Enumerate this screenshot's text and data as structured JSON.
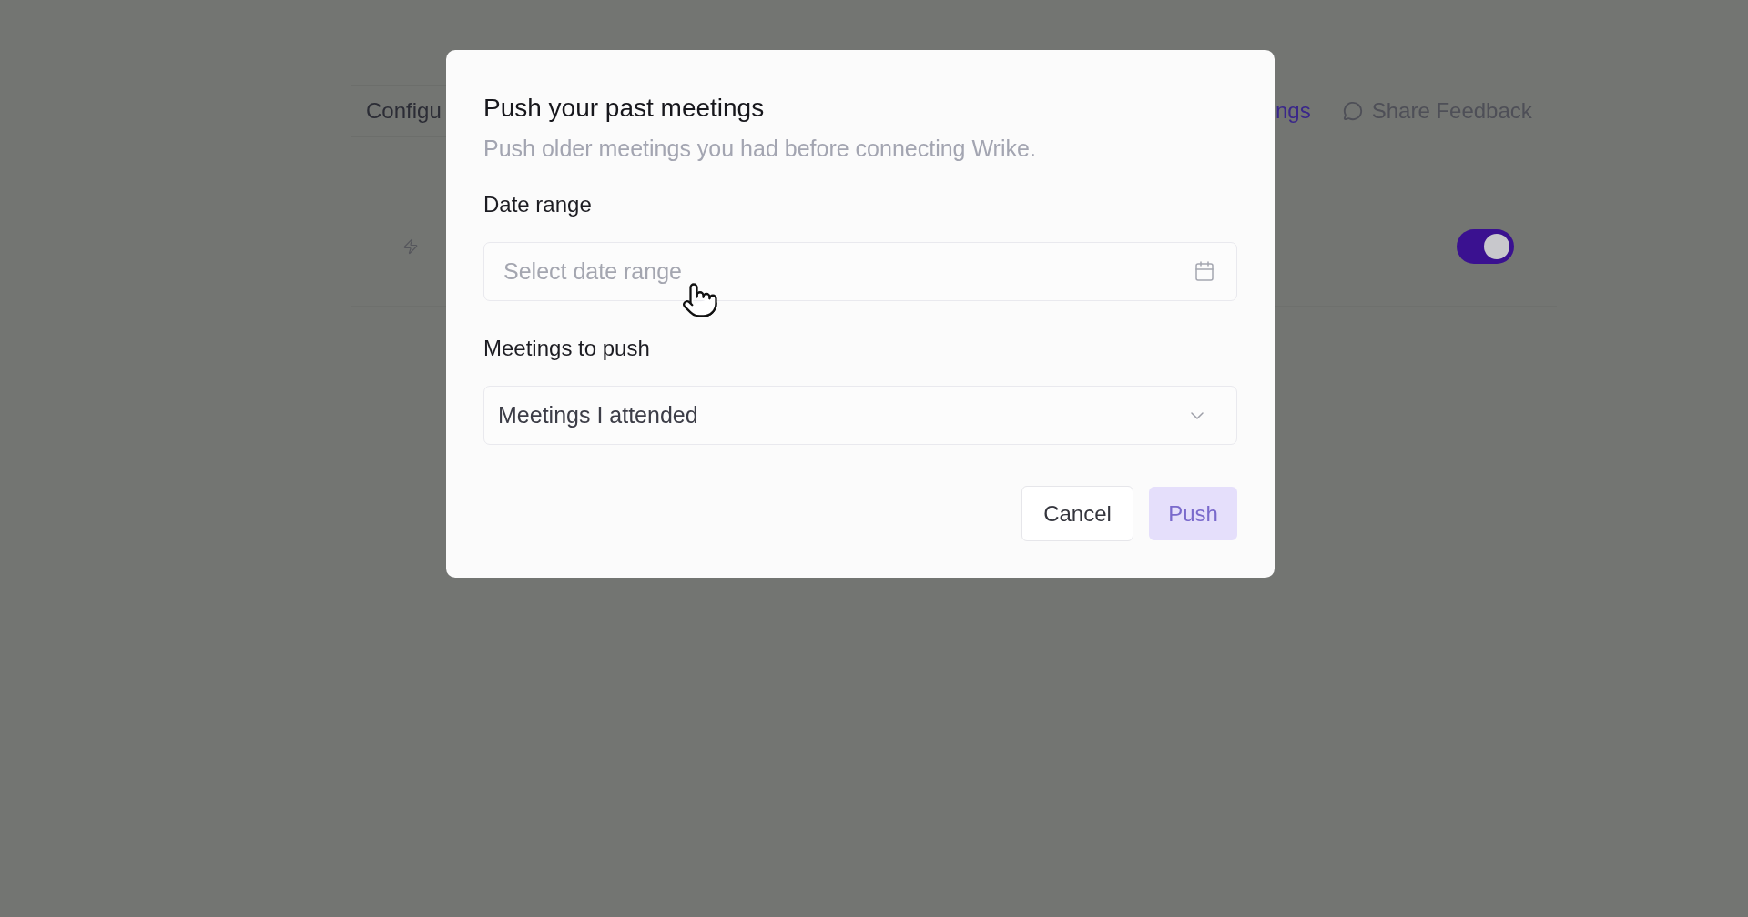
{
  "page": {
    "tabs": [
      {
        "label": "Configu"
      }
    ],
    "link": "ngs",
    "feedback_button": {
      "label": "Share Feedback"
    },
    "automation_row": {
      "toggle": {
        "on": true
      }
    }
  },
  "dialog": {
    "title": "Push your past meetings",
    "subtitle": "Push older meetings you had before connecting Wrike.",
    "fields": [
      {
        "kind": "date",
        "label": "Date range",
        "placeholder": "Select date range"
      },
      {
        "kind": "select",
        "label": "Meetings to push",
        "value": "Meetings I attended"
      }
    ],
    "buttons": [
      {
        "kind": "secondary",
        "label": "Cancel",
        "disabled": false
      },
      {
        "kind": "primary",
        "label": "Push",
        "disabled": true
      }
    ]
  }
}
